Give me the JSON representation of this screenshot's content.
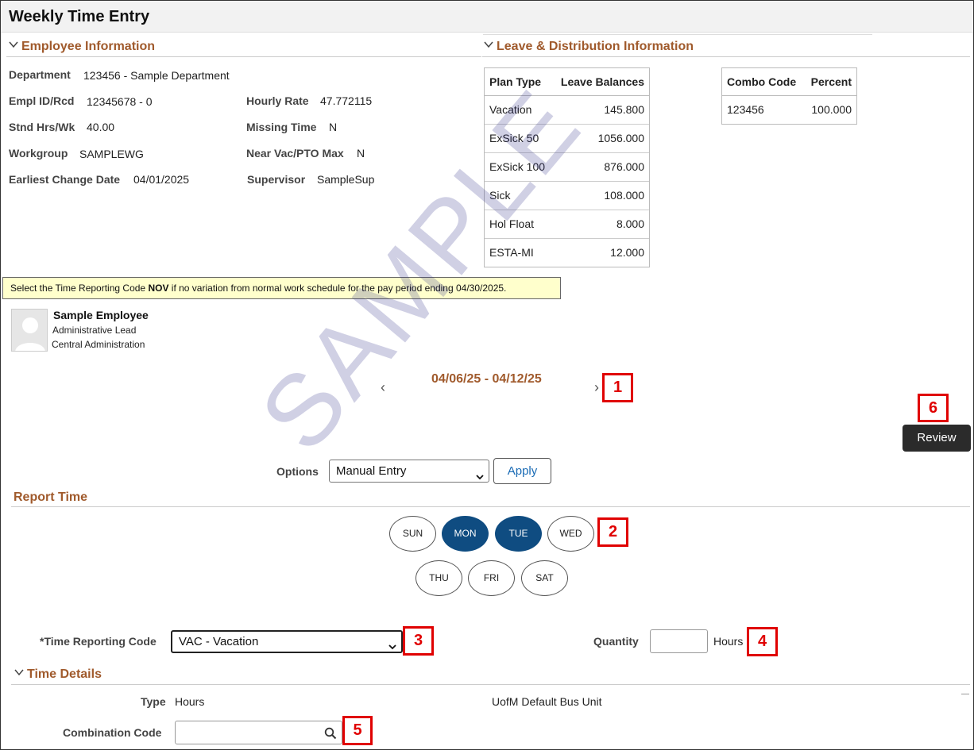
{
  "page": {
    "title": "Weekly Time Entry"
  },
  "employee_info": {
    "heading": "Employee Information",
    "fields": {
      "department": {
        "label": "Department",
        "value": "123456 - Sample Department"
      },
      "empl_id": {
        "label": "Empl ID/Rcd",
        "value": "12345678 - 0"
      },
      "stnd_hrs": {
        "label": "Stnd Hrs/Wk",
        "value": "40.00"
      },
      "workgroup": {
        "label": "Workgroup",
        "value": "SAMPLEWG"
      },
      "earliest_change": {
        "label": "Earliest Change Date",
        "value": "04/01/2025"
      },
      "hourly_rate": {
        "label": "Hourly Rate",
        "value": "47.772115"
      },
      "missing_time": {
        "label": "Missing Time",
        "value": "N"
      },
      "near_vac": {
        "label": "Near Vac/PTO Max",
        "value": "N"
      },
      "supervisor": {
        "label": "Supervisor",
        "value": "SampleSup"
      }
    }
  },
  "leave_info": {
    "heading": "Leave & Distribution Information",
    "balances": {
      "headers": [
        "Plan Type",
        "Leave Balances"
      ],
      "rows": [
        [
          "Vacation",
          "145.800"
        ],
        [
          "ExSick 50",
          "1056.000"
        ],
        [
          "ExSick 100",
          "876.000"
        ],
        [
          "Sick",
          "108.000"
        ],
        [
          "Hol Float",
          "8.000"
        ],
        [
          "ESTA-MI",
          "12.000"
        ]
      ]
    },
    "distribution": {
      "headers": [
        "Combo Code",
        "Percent"
      ],
      "rows": [
        [
          "123456",
          "100.000"
        ]
      ]
    }
  },
  "notice": {
    "pre": "Select the Time Reporting Code ",
    "bold": "NOV",
    "post": " if no variation from normal work schedule for the pay period ending 04/30/2025."
  },
  "person": {
    "name": "Sample Employee",
    "title": "Administrative Lead",
    "dept": "Central Administration"
  },
  "period": {
    "range": "04/06/25 - 04/12/25",
    "prev": "‹",
    "next": "›"
  },
  "review_button": "Review",
  "options": {
    "label": "Options",
    "value": "Manual Entry",
    "apply": "Apply"
  },
  "report_time": {
    "heading": "Report Time",
    "days": [
      {
        "label": "SUN",
        "selected": false
      },
      {
        "label": "MON",
        "selected": true
      },
      {
        "label": "TUE",
        "selected": true
      },
      {
        "label": "WED",
        "selected": false
      },
      {
        "label": "THU",
        "selected": false
      },
      {
        "label": "FRI",
        "selected": false
      },
      {
        "label": "SAT",
        "selected": false
      }
    ],
    "trc_label": "*Time Reporting Code",
    "trc_value": "VAC - Vacation",
    "quantity_label": "Quantity",
    "quantity_value": "",
    "hours_label": "Hours"
  },
  "time_details": {
    "heading": "Time Details",
    "type_label": "Type",
    "type_value": "Hours",
    "bus_unit": "UofM Default Bus Unit",
    "combo_label": "Combination Code",
    "combo_value": ""
  },
  "callouts": [
    "1",
    "2",
    "3",
    "4",
    "5",
    "6"
  ],
  "watermark": "SAMPLE",
  "colors": {
    "accent": "#a05a2c",
    "selected_day": "#0f4c81",
    "callout": "#e00000",
    "notice_bg": "#ffffcc"
  }
}
